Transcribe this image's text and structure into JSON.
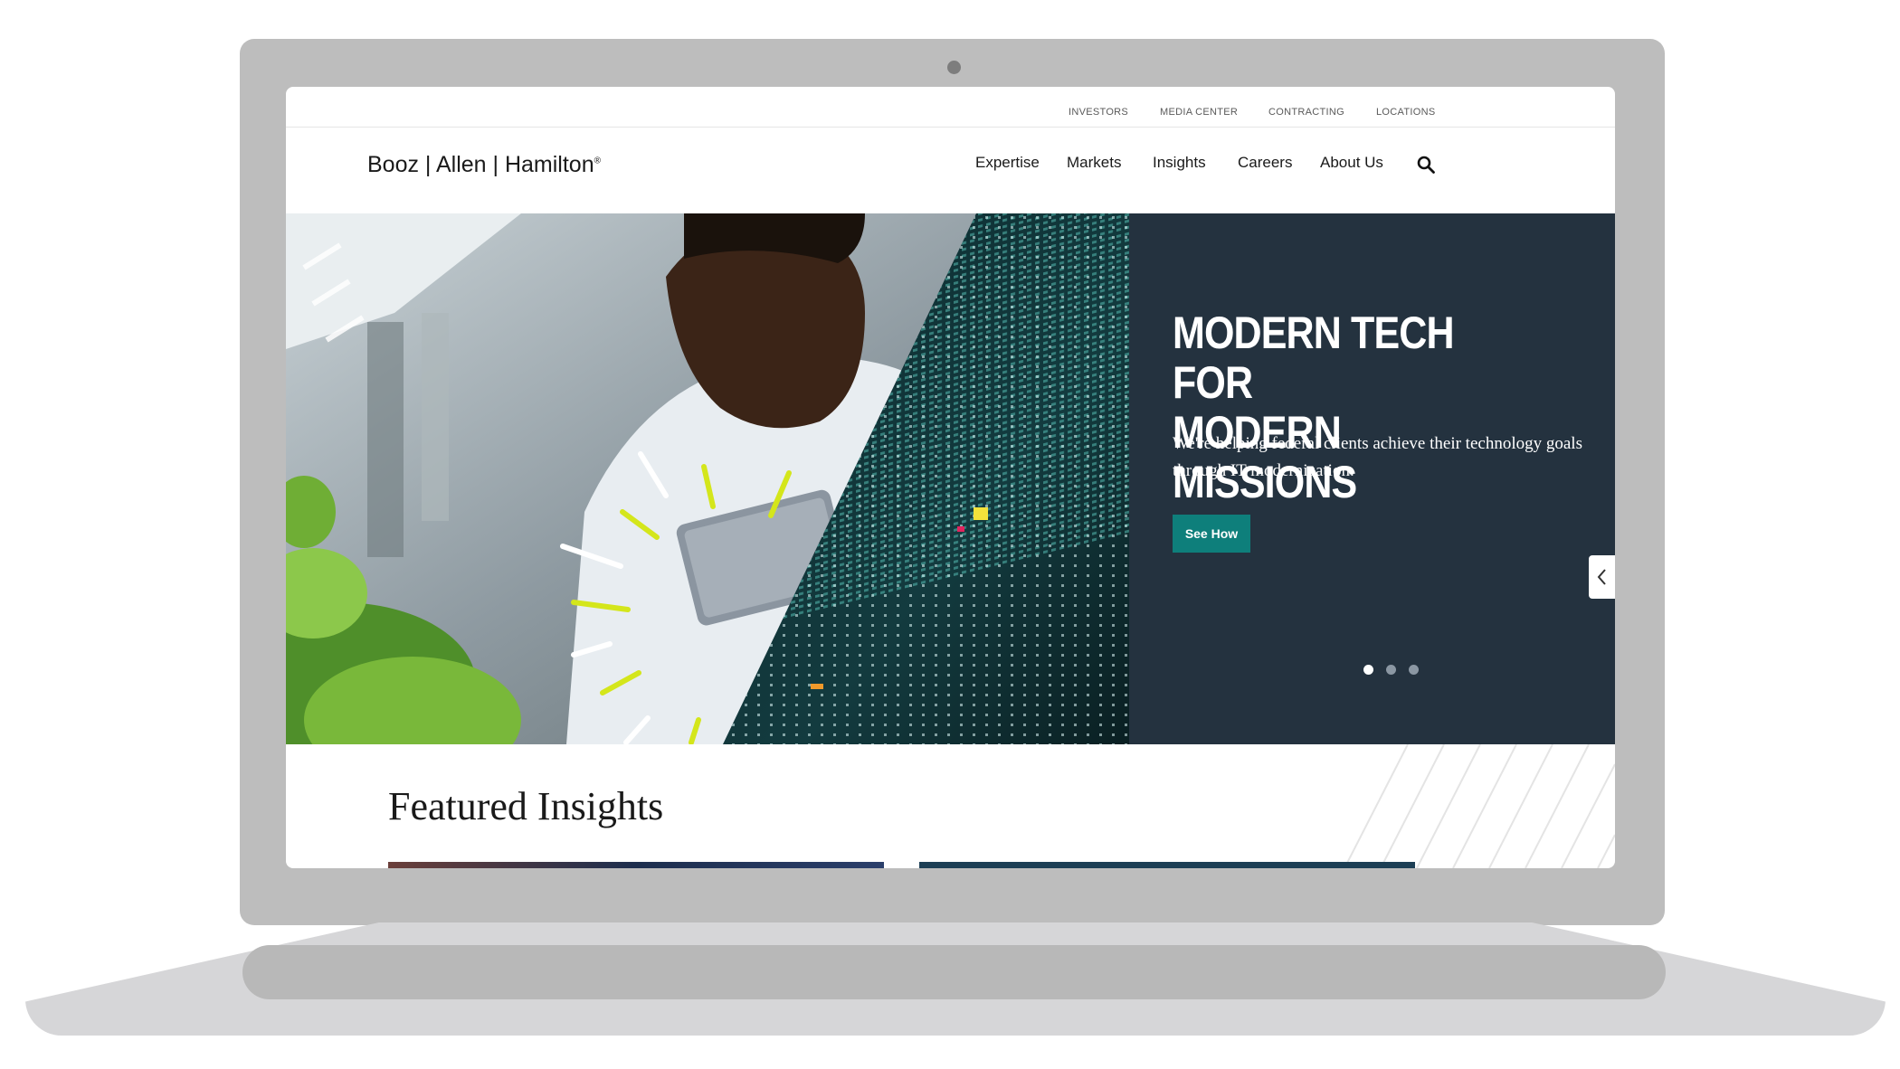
{
  "utility_nav": {
    "items": [
      "INVESTORS",
      "MEDIA CENTER",
      "CONTRACTING",
      "LOCATIONS"
    ]
  },
  "header": {
    "logo_text": "Booz | Allen | Hamilton",
    "logo_mark": "®",
    "nav": [
      "Expertise",
      "Markets",
      "Insights",
      "Careers",
      "About Us"
    ],
    "search_icon": "search-icon"
  },
  "hero": {
    "title_line1": "MODERN TECH FOR",
    "title_line2": "MODERN MISSIONS",
    "body_line1": "We're helping federal clients achieve their technology goals",
    "body_line2": "through IT modernization.",
    "button_label": "See How",
    "slides_total": 3,
    "active_slide": 1,
    "colors": {
      "panel": "#24323f",
      "button": "#0e7f7b",
      "accent": "#d4e61b"
    }
  },
  "featured": {
    "title": "Featured Insights"
  }
}
